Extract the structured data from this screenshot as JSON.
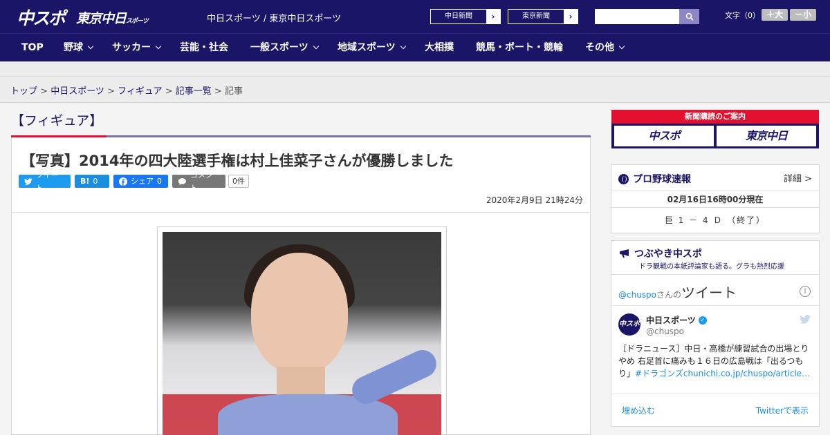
{
  "header": {
    "logo_main": "中スポ",
    "logo_tokyo": "東京中日",
    "logo_tokyo_small": "スポーツ",
    "site_links": "中日スポーツ / 東京中日スポーツ",
    "paper_buttons": [
      "中日新聞",
      "東京新聞"
    ],
    "search_placeholder": "",
    "font_size_label": "文字（0）",
    "font_plus": "＋大",
    "font_minus": "－小"
  },
  "nav": {
    "items": [
      {
        "label": "TOP",
        "dropdown": false
      },
      {
        "label": "野球",
        "dropdown": true
      },
      {
        "label": "サッカー",
        "dropdown": true
      },
      {
        "label": "芸能・社会",
        "dropdown": false
      },
      {
        "label": "一般スポーツ",
        "dropdown": true
      },
      {
        "label": "地域スポーツ",
        "dropdown": true
      },
      {
        "label": "大相撲",
        "dropdown": false
      },
      {
        "label": "競馬・ボート・競輪",
        "dropdown": false
      },
      {
        "label": "その他",
        "dropdown": true
      }
    ]
  },
  "breadcrumb": {
    "items": [
      "トップ",
      "中日スポーツ",
      "フィギュア",
      "記事一覧"
    ],
    "current": "記事",
    "sep": " > "
  },
  "article": {
    "category": "【フィギュア】",
    "title": "【写真】2014年の四大陸選手権は村上佳菜子さんが優勝しました",
    "share": {
      "tweet": "ツイート",
      "hatena": "B!",
      "hatena_count": "0",
      "facebook": "シェア",
      "facebook_count": "0",
      "comment": "コメント",
      "comment_count": "0件"
    },
    "date": "2020年2月9日 21時24分"
  },
  "sidebar": {
    "ad": {
      "title": "新聞購読のご案内",
      "left": "中スポ",
      "right": "東京中日"
    },
    "baseball": {
      "title": "プロ野球速報",
      "more": "詳細 >",
      "time": "02月16日16時00分現在",
      "score": "巨 1 － 4 Ｄ （終了）"
    },
    "tweets": {
      "title": "つぶやき中スポ",
      "subtitle": "ドラ観戦の本紙評論家も語る。グラも熱烈応援",
      "handle_label": "@chuspo",
      "san_no": "さんの",
      "tweet_word": "ツイート",
      "avatar_text": "中スポ",
      "account_name": "中日スポーツ",
      "account_handle": "@chuspo",
      "text": "［ドラニュース］中日・高橋が練習試合の出場とりやめ 右足首に痛みも１６日の広島戦は「出るつもり」",
      "tag": "#ドラゴンズ",
      "link": "chunichi.co.jp/chuspo/article…",
      "embed": "埋め込む",
      "view_on_twitter": "Twitterで表示"
    }
  },
  "colors": {
    "brand_navy": "#1b1567",
    "accent_red": "#e3102f",
    "twitter_blue": "#1d9bf0"
  }
}
